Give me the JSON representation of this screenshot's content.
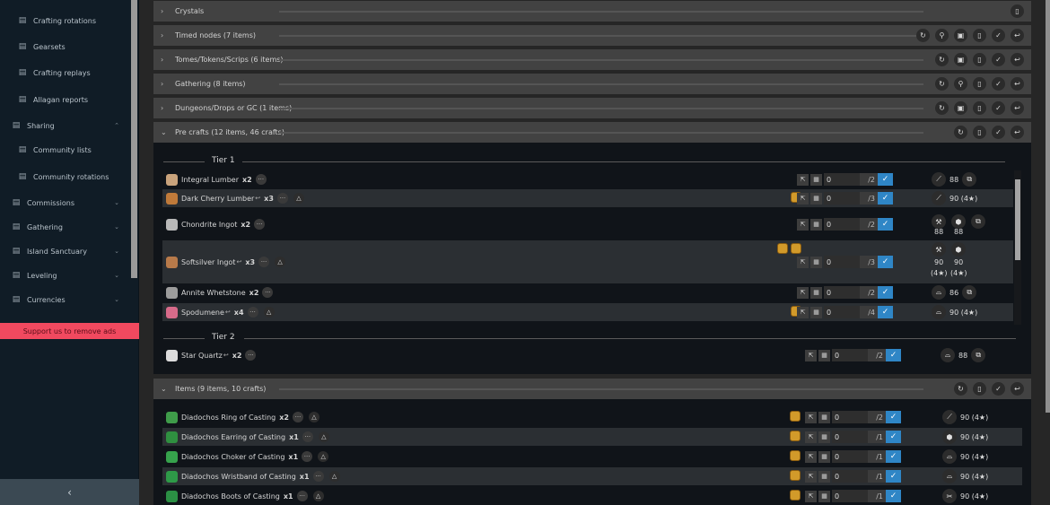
{
  "sidebar": {
    "items": [
      {
        "label": "Crafting rotations",
        "icon": "rotation-icon",
        "child": true
      },
      {
        "label": "Gearsets",
        "icon": "gearset-icon",
        "child": true
      },
      {
        "label": "Crafting replays",
        "icon": "replay-icon",
        "child": true
      },
      {
        "label": "Allagan reports",
        "icon": "report-icon",
        "child": true
      },
      {
        "label": "Sharing",
        "icon": "share-icon",
        "child": false,
        "chev": "⌃",
        "active": true
      },
      {
        "label": "Community lists",
        "icon": "list-icon",
        "child": true
      },
      {
        "label": "Community rotations",
        "icon": "community-rotation-icon",
        "child": true
      },
      {
        "label": "Commissions",
        "icon": "commission-icon",
        "child": false,
        "chev": "⌄"
      },
      {
        "label": "Gathering",
        "icon": "pickaxe-icon",
        "child": false,
        "chev": "⌄"
      },
      {
        "label": "Island Sanctuary",
        "icon": "island-icon",
        "child": false,
        "chev": "⌄"
      },
      {
        "label": "Leveling",
        "icon": "leveling-icon",
        "child": false,
        "chev": "⌄"
      },
      {
        "label": "Currencies",
        "icon": "currency-icon",
        "child": false,
        "chev": "⌄"
      }
    ],
    "ad": "Support us to remove ads",
    "collapse": "‹"
  },
  "panels": [
    {
      "title": "Crystals",
      "arrow": "›",
      "actions": [
        "▯"
      ]
    },
    {
      "title": "Timed nodes (7 items)",
      "arrow": "›",
      "actions": [
        "↻",
        "⚲",
        "▣",
        "▯",
        "✓",
        "↩"
      ]
    },
    {
      "title": "Tomes/Tokens/Scrips (6 items)",
      "arrow": "›",
      "actions": [
        "↻",
        "▣",
        "▯",
        "✓",
        "↩"
      ]
    },
    {
      "title": "Gathering (8 items)",
      "arrow": "›",
      "actions": [
        "↻",
        "⚲",
        "▯",
        "✓",
        "↩"
      ]
    },
    {
      "title": "Dungeons/Drops or GC (1 items)",
      "arrow": "›",
      "actions": [
        "↻",
        "▣",
        "▯",
        "✓",
        "↩"
      ]
    },
    {
      "title": "Pre crafts  (12 items, 46 crafts)",
      "arrow": "⌄",
      "actions": [
        "↻",
        "▯",
        "✓",
        "↩"
      ]
    },
    {
      "title": "Items  (9 items, 10 crafts)",
      "arrow": "⌄",
      "actions": [
        "↻",
        "▯",
        "✓",
        "↩"
      ]
    }
  ],
  "precrafts": {
    "tier1": "Tier 1",
    "tier2": "Tier 2",
    "rows": [
      {
        "name": "Integral Lumber",
        "qty": "x2",
        "dl": "",
        "warn": false,
        "coins": 0,
        "done": "0",
        "need": "/2",
        "jobs": [
          "⟋"
        ],
        "job_levels": [
          "88"
        ],
        "extra": "⧉",
        "icon_color": "#c9a37c"
      },
      {
        "name": "Dark Cherry Lumber",
        "qty": "x3",
        "dl": "↩",
        "warn": true,
        "coins": 1,
        "done": "0",
        "need": "/3",
        "jobs": [
          "⟋"
        ],
        "job_levels": [
          "90 (4★)"
        ],
        "extra": "",
        "icon_color": "#c07a3a"
      },
      {
        "name": "Chondrite Ingot",
        "qty": "x2",
        "dl": "",
        "warn": false,
        "coins": 0,
        "done": "0",
        "need": "/2",
        "jobs": [
          "⚒",
          "⬢"
        ],
        "job_levels": [
          "88",
          "88"
        ],
        "extra": "⧉",
        "icon_color": "#b9b9b9",
        "stacked": true
      },
      {
        "name": "Softsilver Ingot",
        "qty": "x3",
        "dl": "↩",
        "warn": true,
        "coins": 2,
        "done": "0",
        "need": "/3",
        "jobs": [
          "⚒",
          "⬢"
        ],
        "job_levels": [
          "90",
          "90"
        ],
        "sub": [
          "(4★)",
          "(4★)"
        ],
        "extra": "",
        "icon_color": "#b87a4a",
        "stacked": true,
        "tall": true
      },
      {
        "name": "Annite Whetstone",
        "qty": "x2",
        "dl": "",
        "warn": false,
        "coins": 0,
        "done": "0",
        "need": "/2",
        "jobs": [
          "⌓"
        ],
        "job_levels": [
          "86"
        ],
        "extra": "⧉",
        "icon_color": "#9c9c9c"
      },
      {
        "name": "Spodumene",
        "qty": "x4",
        "dl": "↩",
        "warn": true,
        "coins": 1,
        "done": "0",
        "need": "/4",
        "jobs": [
          "⌓"
        ],
        "job_levels": [
          "90 (4★)"
        ],
        "extra": "",
        "icon_color": "#d86b8a"
      },
      {
        "name": "Star Quartz",
        "qty": "x2",
        "dl": "↩",
        "warn": false,
        "coins": 0,
        "done": "0",
        "need": "/2",
        "jobs": [
          "⌓"
        ],
        "job_levels": [
          "88"
        ],
        "extra": "⧉",
        "icon_color": "#dcdcdc"
      }
    ]
  },
  "items": {
    "rows": [
      {
        "name": "Diadochos Ring of Casting",
        "qty": "x2",
        "done": "0",
        "need": "/2",
        "job": "⟋",
        "level": "90 (4★)",
        "icon_color": "#3f9c4a"
      },
      {
        "name": "Diadochos Earring of Casting",
        "qty": "x1",
        "done": "0",
        "need": "/1",
        "job": "⬢",
        "level": "90 (4★)",
        "icon_color": "#2f8f40"
      },
      {
        "name": "Diadochos Choker of Casting",
        "qty": "x1",
        "done": "0",
        "need": "/1",
        "job": "⌓",
        "level": "90 (4★)",
        "icon_color": "#36a24c"
      },
      {
        "name": "Diadochos Wristband of Casting",
        "qty": "x1",
        "done": "0",
        "need": "/1",
        "job": "⌓",
        "level": "90 (4★)",
        "icon_color": "#2e9a48"
      },
      {
        "name": "Diadochos Boots of Casting",
        "qty": "x1",
        "done": "0",
        "need": "/1",
        "job": "✂",
        "level": "90 (4★)",
        "icon_color": "#2b8f44"
      }
    ]
  },
  "colors": {
    "accent": "#2f86c6",
    "ad": "#f1495f",
    "coin": "#d29a2a"
  }
}
